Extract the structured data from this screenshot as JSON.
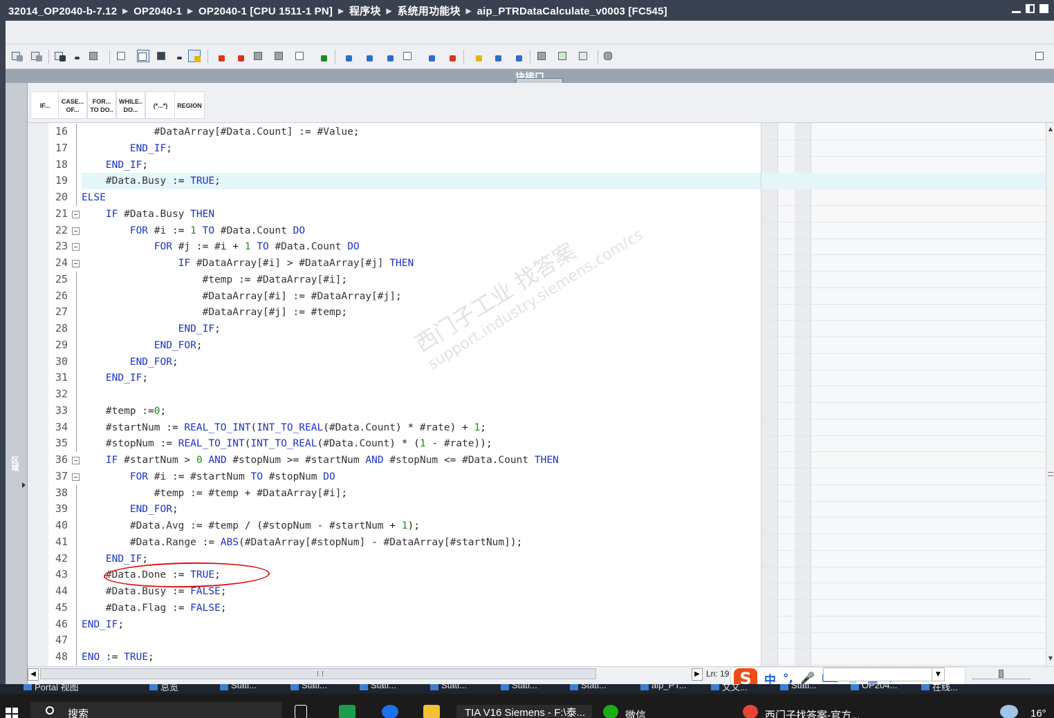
{
  "breadcrumbs": [
    "32014_OP2040-b-7.12",
    "OP2040-1",
    "OP2040-1 [CPU 1511-1 PN]",
    "程序块",
    "系统用功能块",
    "aip_PTRDataCalculate_v0003 [FC545]"
  ],
  "interface_bar": {
    "label": "块接口"
  },
  "side_tab": {
    "label": "区域"
  },
  "templates": [
    {
      "line1": "IF...",
      "line2": ""
    },
    {
      "line1": "CASE...",
      "line2": "OF..."
    },
    {
      "line1": "FOR...",
      "line2": "TO DO.."
    },
    {
      "line1": "WHILE..",
      "line2": "DO..."
    },
    {
      "line1": "(*...*)",
      "line2": ""
    },
    {
      "line1": "REGION",
      "line2": ""
    }
  ],
  "code_lines": [
    {
      "n": "16",
      "fold": "",
      "indent": 3,
      "text": "#DataArray[#Data.Count] := #Value;"
    },
    {
      "n": "17",
      "fold": "",
      "indent": 2,
      "text": "END_IF;"
    },
    {
      "n": "18",
      "fold": "",
      "indent": 1,
      "text": "END_IF;"
    },
    {
      "n": "19",
      "fold": "",
      "indent": 1,
      "text": "#Data.Busy := TRUE;"
    },
    {
      "n": "20",
      "fold": "",
      "indent": 0,
      "text": "ELSE"
    },
    {
      "n": "21",
      "fold": "box",
      "indent": 1,
      "text": "IF #Data.Busy THEN"
    },
    {
      "n": "22",
      "fold": "box",
      "indent": 2,
      "text": "FOR #i := 1 TO #Data.Count DO"
    },
    {
      "n": "23",
      "fold": "box",
      "indent": 3,
      "text": "FOR #j := #i + 1 TO #Data.Count DO"
    },
    {
      "n": "24",
      "fold": "box",
      "indent": 4,
      "text": "IF #DataArray[#i] > #DataArray[#j] THEN"
    },
    {
      "n": "25",
      "fold": "",
      "indent": 5,
      "text": "#temp := #DataArray[#i];"
    },
    {
      "n": "26",
      "fold": "",
      "indent": 5,
      "text": "#DataArray[#i] := #DataArray[#j];"
    },
    {
      "n": "27",
      "fold": "",
      "indent": 5,
      "text": "#DataArray[#j] := #temp;"
    },
    {
      "n": "28",
      "fold": "",
      "indent": 4,
      "text": "END_IF;"
    },
    {
      "n": "29",
      "fold": "",
      "indent": 3,
      "text": "END_FOR;"
    },
    {
      "n": "30",
      "fold": "",
      "indent": 2,
      "text": "END_FOR;"
    },
    {
      "n": "31",
      "fold": "",
      "indent": 1,
      "text": "END_IF;"
    },
    {
      "n": "32",
      "fold": "",
      "indent": 0,
      "text": ""
    },
    {
      "n": "33",
      "fold": "",
      "indent": 1,
      "text": "#temp :=0;"
    },
    {
      "n": "34",
      "fold": "",
      "indent": 1,
      "text": "#startNum := REAL_TO_INT(INT_TO_REAL(#Data.Count) * #rate) + 1;"
    },
    {
      "n": "35",
      "fold": "",
      "indent": 1,
      "text": "#stopNum := REAL_TO_INT(INT_TO_REAL(#Data.Count) * (1 - #rate));"
    },
    {
      "n": "36",
      "fold": "box",
      "indent": 1,
      "text": "IF #startNum > 0 AND #stopNum >= #startNum AND #stopNum <= #Data.Count THEN"
    },
    {
      "n": "37",
      "fold": "box",
      "indent": 2,
      "text": "FOR #i := #startNum TO #stopNum DO"
    },
    {
      "n": "38",
      "fold": "",
      "indent": 3,
      "text": "#temp := #temp + #DataArray[#i];"
    },
    {
      "n": "39",
      "fold": "",
      "indent": 2,
      "text": "END_FOR;"
    },
    {
      "n": "40",
      "fold": "",
      "indent": 2,
      "text": "#Data.Avg := #temp / (#stopNum - #startNum + 1);"
    },
    {
      "n": "41",
      "fold": "",
      "indent": 2,
      "text": "#Data.Range := ABS(#DataArray[#stopNum] - #DataArray[#startNum]);"
    },
    {
      "n": "42",
      "fold": "",
      "indent": 1,
      "text": "END_IF;"
    },
    {
      "n": "43",
      "fold": "",
      "indent": 1,
      "text": "#Data.Done := TRUE;"
    },
    {
      "n": "44",
      "fold": "",
      "indent": 1,
      "text": "#Data.Busy := FALSE;"
    },
    {
      "n": "45",
      "fold": "",
      "indent": 1,
      "text": "#Data.Flag := FALSE;"
    },
    {
      "n": "46",
      "fold": "",
      "indent": 0,
      "text": "END_IF;"
    },
    {
      "n": "47",
      "fold": "",
      "indent": 0,
      "text": ""
    },
    {
      "n": "48",
      "fold": "",
      "indent": 0,
      "text": "ENO := TRUE;"
    }
  ],
  "current_line": "19",
  "keywords": [
    "IF",
    "THEN",
    "ELSE",
    "END_IF",
    "FOR",
    "TO",
    "DO",
    "END_FOR",
    "AND",
    "TRUE",
    "FALSE",
    "ENO",
    "REAL_TO_INT",
    "INT_TO_REAL",
    "ABS"
  ],
  "watermark": {
    "cn": "西门子工业  找答案",
    "url": "support.industry.siemens.com/cs"
  },
  "status": {
    "ln_label": "Ln: 19"
  },
  "ime": {
    "logo": "S",
    "items": [
      "中",
      "°,",
      "🎤",
      "⌨",
      "👕",
      "▦",
      "⚙"
    ]
  },
  "portal_tabs": [
    "Portal 视图",
    "总览",
    "Stati...",
    "Stati...",
    "Stati...",
    "Stati...",
    "Stati...",
    "Stati...",
    "aip_PT...",
    "文文...",
    "Stati...",
    "OP204...",
    "在线..."
  ],
  "taskbar": {
    "search_placeholder": "搜索",
    "apps": [
      "TIA V16 Siemens - F:\\泰...",
      "微信",
      "西门子找答案-官方..."
    ],
    "temp": "16°"
  }
}
